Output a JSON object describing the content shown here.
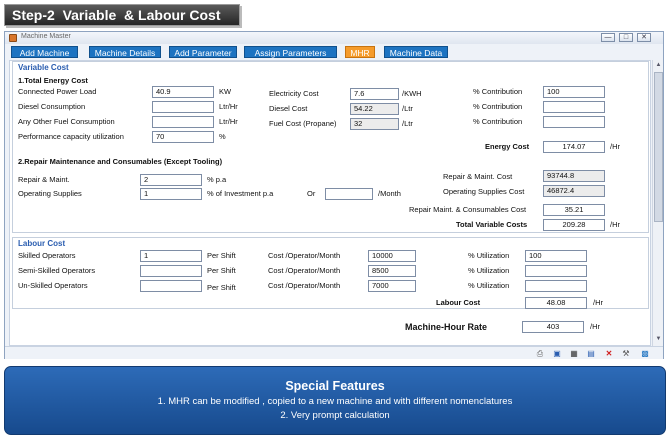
{
  "banner": {
    "title": "Step-2  Variable  & Labour Cost"
  },
  "window": {
    "title": "Machine Master",
    "controls": [
      "—",
      "□",
      "✕"
    ]
  },
  "tabs": [
    {
      "label": "Add Machine"
    },
    {
      "label": "Machine Details"
    },
    {
      "label": "Add Parameter"
    },
    {
      "label": "Assign Parameters"
    },
    {
      "label": "MHR",
      "active": true
    },
    {
      "label": "Machine Data"
    }
  ],
  "variable_cost": {
    "group_title": "Variable Cost",
    "energy": {
      "section_title": "1.Total Energy Cost",
      "connected_power": {
        "label": "Connected Power Load",
        "value": "40.9",
        "unit": "KW"
      },
      "diesel_consumption": {
        "label": "Diesel Consumption",
        "value": "",
        "unit": "Ltr/Hr"
      },
      "other_fuel": {
        "label": "Any Other Fuel Consumption",
        "value": "",
        "unit": "Ltr/Hr"
      },
      "capacity_utilization": {
        "label": "Performance capacity utilization",
        "value": "70",
        "unit": "%"
      },
      "electricity_cost": {
        "label": "Electricity Cost",
        "value": "7.6",
        "unit": "/KWH"
      },
      "diesel_cost": {
        "label": "Diesel Cost",
        "value": "54.22",
        "unit": "/Ltr"
      },
      "fuel_cost": {
        "label": "Fuel Cost (Propane)",
        "value": "32",
        "unit": "/Ltr"
      },
      "contribution_1": {
        "label": "% Contribution",
        "value": "100"
      },
      "contribution_2": {
        "label": "% Contribution",
        "value": ""
      },
      "contribution_3": {
        "label": "% Contribution",
        "value": ""
      },
      "energy_cost": {
        "label": "Energy Cost",
        "value": "174.07",
        "unit": "/Hr"
      }
    },
    "repair": {
      "section_title": "2.Repair Maintenance and Consumables (Except Tooling)",
      "repair_maint": {
        "label": "Repair & Maint.",
        "value": "2",
        "unit": "% p.a"
      },
      "operating_supplies": {
        "label": "Operating Supplies",
        "value": "1",
        "unit": "% of Investment p.a"
      },
      "or_label": "Or",
      "per_month": {
        "value": "",
        "unit": "/Month"
      },
      "repair_maint_cost": {
        "label": "Repair & Maint. Cost",
        "value": "93744.8"
      },
      "operating_supplies_cost": {
        "label": "Operating Supplies Cost",
        "value": "46872.4"
      },
      "repair_consumables_cost": {
        "label": "Repair Maint. & Consumables Cost",
        "value": "35.21"
      },
      "total_variable_costs": {
        "label": "Total Variable Costs",
        "value": "209.28",
        "unit": "/Hr"
      }
    }
  },
  "labour_cost": {
    "group_title": "Labour Cost",
    "rows": [
      {
        "label": "Skilled Operators",
        "count": "1",
        "per_shift": "Per Shift",
        "cost_label": "Cost /Operator/Month",
        "cost": "10000",
        "util_label": "% Utilization",
        "util": "100"
      },
      {
        "label": "Semi-Skilled Operators",
        "count": "",
        "per_shift": "Per Shift",
        "cost_label": "Cost /Operator/Month",
        "cost": "8500",
        "util_label": "% Utilization",
        "util": ""
      },
      {
        "label": "Un-Skilled Operators",
        "count": "",
        "per_shift": "Per Shift",
        "cost_label": "Cost /Operator/Month",
        "cost": "7000",
        "util_label": "% Utilization",
        "util": ""
      }
    ],
    "labour_total": {
      "label": "Labour Cost",
      "value": "48.08",
      "unit": "/Hr"
    }
  },
  "mhr": {
    "label": "Machine-Hour Rate",
    "value": "403",
    "unit": "/Hr"
  },
  "toolbar_icons": [
    "print-icon",
    "save-icon",
    "grid-icon",
    "calendar-icon",
    "delete-icon",
    "tools-icon",
    "exit-icon"
  ],
  "features": {
    "title": "Special Features",
    "lines": [
      "1.   MHR can be modified , copied to a new machine and with different nomenclatures",
      "2.   Very prompt calculation"
    ]
  }
}
